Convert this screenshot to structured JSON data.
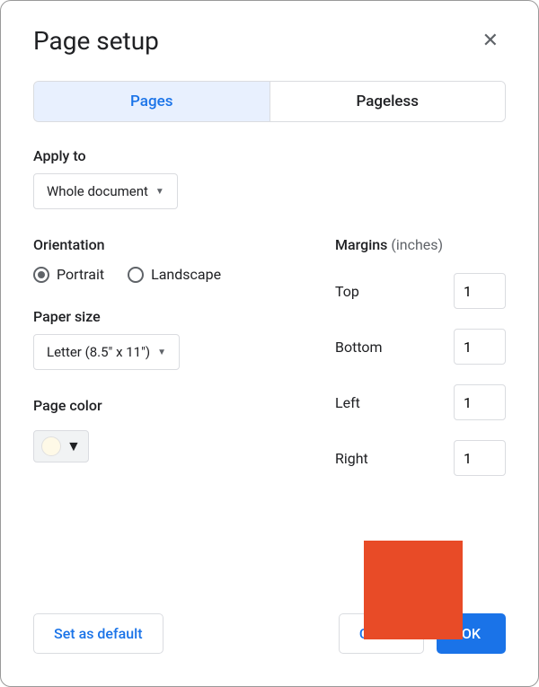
{
  "dialog": {
    "title": "Page setup"
  },
  "tabs": {
    "pages": "Pages",
    "pageless": "Pageless"
  },
  "apply_to": {
    "label": "Apply to",
    "value": "Whole document"
  },
  "orientation": {
    "label": "Orientation",
    "portrait": "Portrait",
    "landscape": "Landscape",
    "selected": "portrait"
  },
  "paper_size": {
    "label": "Paper size",
    "value": "Letter (8.5\" x 11\")"
  },
  "page_color": {
    "label": "Page color",
    "value": "#fef9e7"
  },
  "margins": {
    "label": "Margins",
    "units": "(inches)",
    "top_label": "Top",
    "bottom_label": "Bottom",
    "left_label": "Left",
    "right_label": "Right",
    "top": "1",
    "bottom": "1",
    "left": "1",
    "right": "1"
  },
  "buttons": {
    "set_default": "Set as default",
    "cancel": "Cancel",
    "ok": "OK"
  }
}
